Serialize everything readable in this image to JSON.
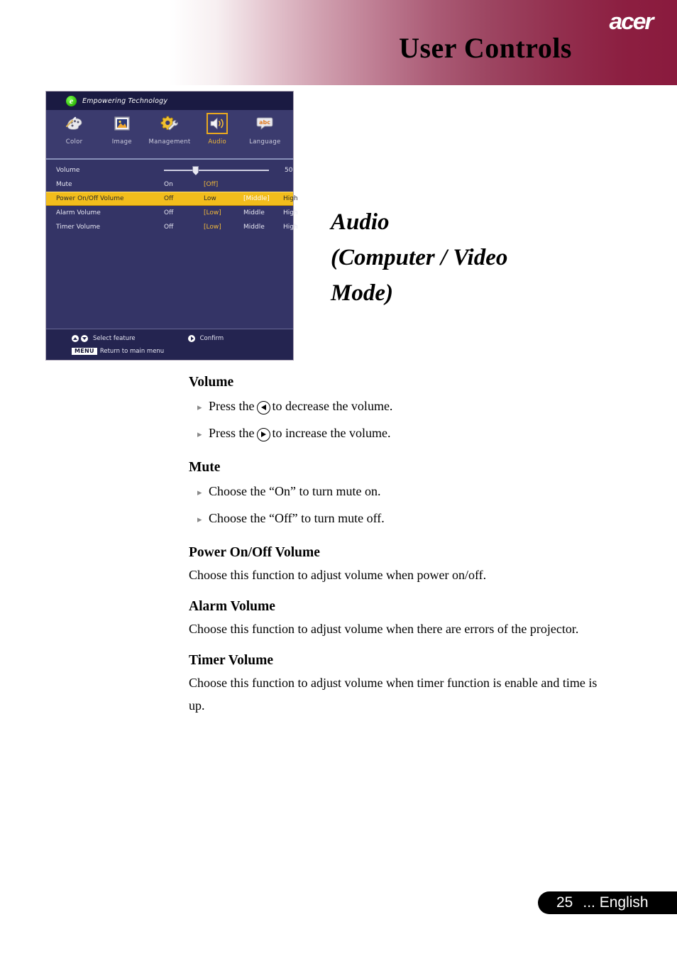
{
  "header": {
    "title": "User Controls",
    "brand": "acer"
  },
  "osd": {
    "topbar": {
      "logo_letter": "e",
      "empowering_label": "Empowering Technology"
    },
    "icons": [
      {
        "label": "Color",
        "icon": "palette-icon",
        "selected": false
      },
      {
        "label": "Image",
        "icon": "picture-icon",
        "selected": false
      },
      {
        "label": "Management",
        "icon": "gear-wrench-icon",
        "selected": false
      },
      {
        "label": "Audio",
        "icon": "speaker-icon",
        "selected": true
      },
      {
        "label": "Language",
        "icon": "abc-bubble-icon",
        "selected": false
      }
    ],
    "rows": [
      {
        "label": "Volume",
        "type": "slider",
        "value": "50",
        "thumb_percent": 30
      },
      {
        "label": "Mute",
        "type": "options",
        "options": [
          {
            "text": "On",
            "selected": false
          },
          {
            "text": "[Off]",
            "selected": true
          }
        ],
        "highlight": false
      },
      {
        "label": "Power On/Off Volume",
        "type": "options",
        "options": [
          {
            "text": "Off",
            "selected": false
          },
          {
            "text": "Low",
            "selected": false
          },
          {
            "text": "[Middle]",
            "selected": true
          },
          {
            "text": "High",
            "selected": false
          }
        ],
        "highlight": true
      },
      {
        "label": "Alarm Volume",
        "type": "options",
        "options": [
          {
            "text": "Off",
            "selected": false
          },
          {
            "text": "[Low]",
            "selected": true
          },
          {
            "text": "Middle",
            "selected": false
          },
          {
            "text": "High",
            "selected": false
          }
        ],
        "highlight": false
      },
      {
        "label": "Timer Volume",
        "type": "options",
        "options": [
          {
            "text": "Off",
            "selected": false
          },
          {
            "text": "[Low]",
            "selected": true
          },
          {
            "text": "Middle",
            "selected": false
          },
          {
            "text": "High",
            "selected": false
          }
        ],
        "highlight": false
      }
    ],
    "hints": {
      "select_feature": "Select feature",
      "confirm": "Confirm",
      "menu_key": "MENU",
      "return_main": "Return to main menu"
    }
  },
  "side_heading": {
    "line1": "Audio",
    "line2": "(Computer / Video",
    "line3": "Mode)"
  },
  "sections": [
    {
      "title": "Volume",
      "bullets": [
        {
          "pre": "Press the",
          "key": "left-arrow-key",
          "post": "to decrease the volume."
        },
        {
          "pre": "Press the",
          "key": "right-arrow-key",
          "post": "to increase the volume."
        }
      ]
    },
    {
      "title": "Mute",
      "bullets": [
        {
          "pre": "Choose the “On” to turn mute on.",
          "key": null,
          "post": ""
        },
        {
          "pre": "Choose the “Off” to turn mute off.",
          "key": null,
          "post": ""
        }
      ]
    },
    {
      "title": "Power On/Off Volume",
      "paragraph": "Choose this function to adjust volume when power on/off."
    },
    {
      "title": "Alarm Volume",
      "paragraph": "Choose this function to adjust volume when there are errors of the projector."
    },
    {
      "title": "Timer Volume",
      "paragraph": "Choose this function to adjust volume when timer function is enable and time is up."
    }
  ],
  "footer": {
    "page_number": "25",
    "language": "... English"
  },
  "colors": {
    "header_accent": "#8a1a3d",
    "osd_background": "#343466",
    "osd_topbar": "#1a1a42",
    "osd_iconbar": "#3b3b6e",
    "osd_highlight": "#f2bd1c",
    "osd_selected_text": "#f0b83a",
    "osd_bottombar": "#242450",
    "footer_pill": "#000000"
  }
}
